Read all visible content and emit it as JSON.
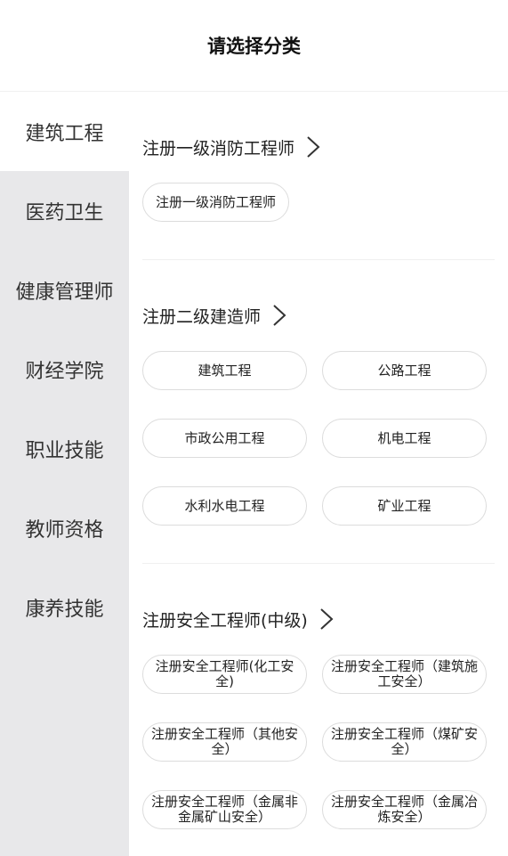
{
  "header": {
    "title": "请选择分类"
  },
  "sidebar": {
    "items": [
      {
        "label": "建筑工程",
        "active": true
      },
      {
        "label": "医药卫生",
        "active": false
      },
      {
        "label": "健康管理师",
        "active": false
      },
      {
        "label": "财经学院",
        "active": false
      },
      {
        "label": "职业技能",
        "active": false
      },
      {
        "label": "教师资格",
        "active": false
      },
      {
        "label": "康养技能",
        "active": false
      }
    ]
  },
  "sections": [
    {
      "title": "注册一级消防工程师",
      "chips": [
        "注册一级消防工程师"
      ]
    },
    {
      "title": "注册二级建造师",
      "chips": [
        "建筑工程",
        "公路工程",
        "市政公用工程",
        "机电工程",
        "水利水电工程",
        "矿业工程"
      ]
    },
    {
      "title": "注册安全工程师(中级)",
      "chips": [
        "注册安全工程师(化工安全)",
        "注册安全工程师（建筑施工安全）",
        "注册安全工程师（其他安全）",
        "注册安全工程师（煤矿安全）",
        "注册安全工程师（金属非金属矿山安全）",
        "注册安全工程师（金属冶炼安全）"
      ]
    }
  ]
}
